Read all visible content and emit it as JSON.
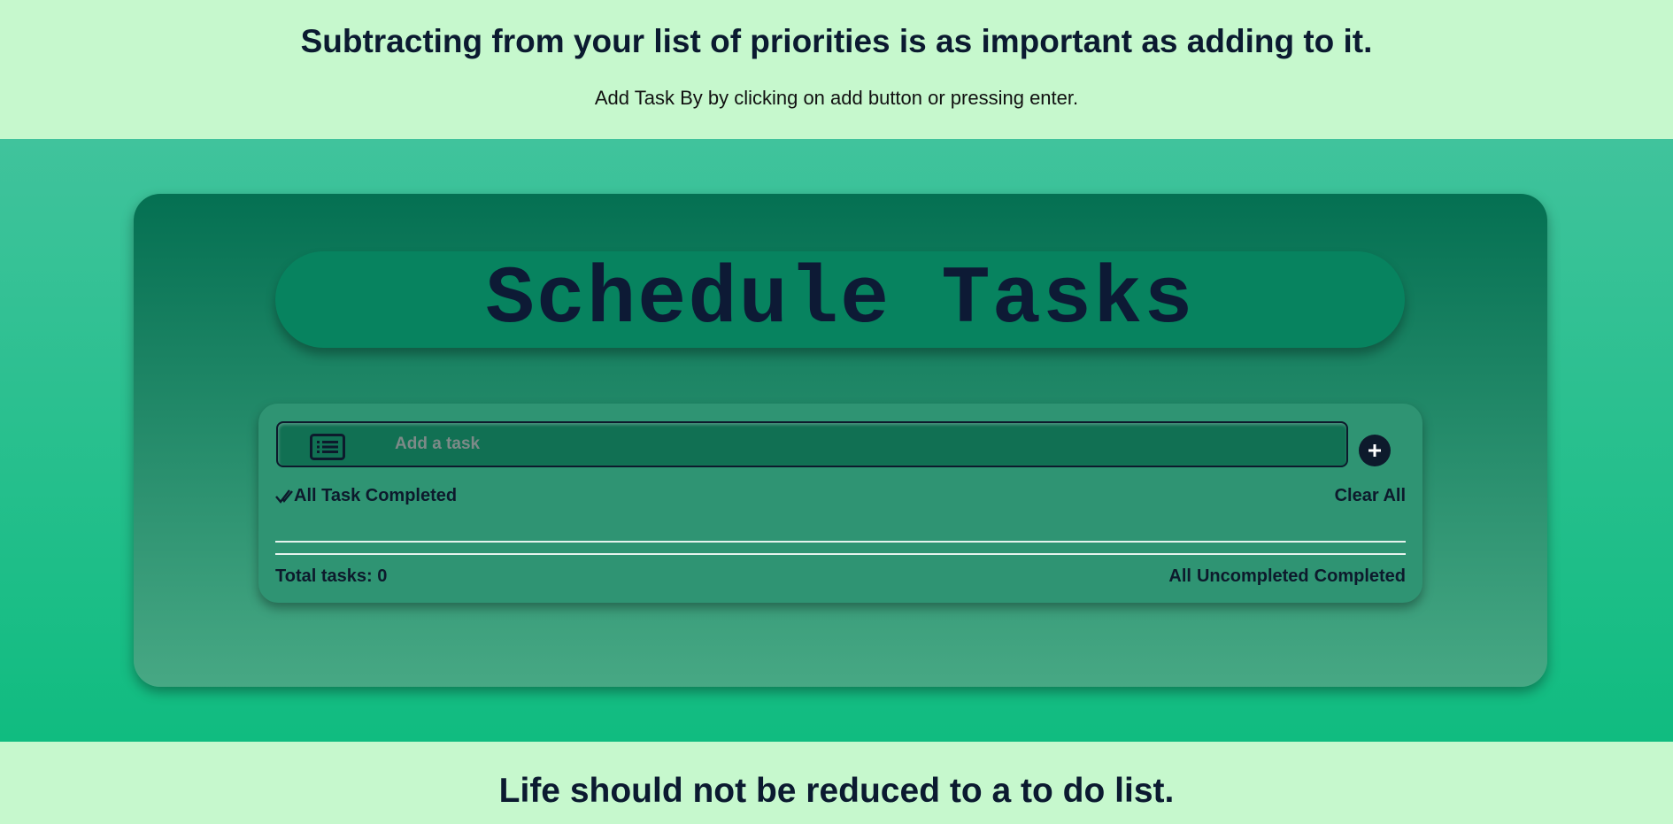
{
  "header": {
    "quote": "Subtracting from your list of priorities is as important as adding to it.",
    "hint": "Add Task By by clicking on add button or pressing enter."
  },
  "app": {
    "title": "Schedule Tasks",
    "input": {
      "placeholder": "Add a task",
      "value": ""
    },
    "add_button_icon": "plus-icon",
    "list_icon": "list-icon",
    "complete_all_label": "All Task Completed",
    "clear_all_label": "Clear All",
    "total_tasks_label": "Total tasks: 0",
    "filters": [
      "All",
      "Uncompleted",
      "Completed"
    ]
  },
  "footer": {
    "quote": "Life should not be reduced to a to do list."
  },
  "colors": {
    "banner_bg": "#c6f8cd",
    "card_top": "#047052",
    "card_bottom": "#47a884",
    "dark_text": "#0d1a2c"
  }
}
